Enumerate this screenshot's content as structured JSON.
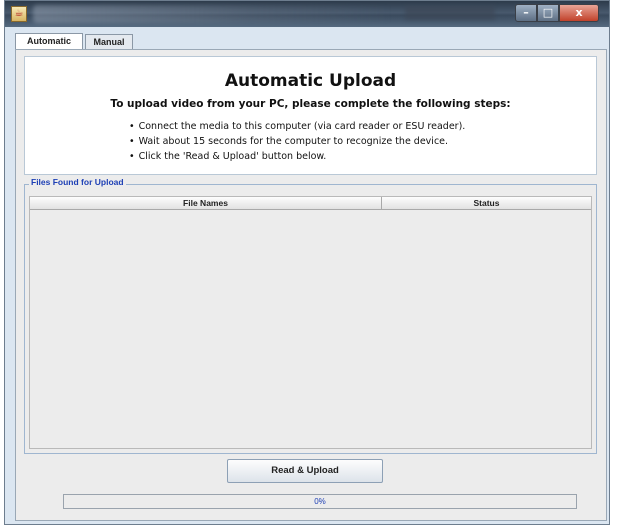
{
  "window": {
    "app_icon": "java-cup-icon",
    "controls": {
      "minimize": "–",
      "maximize": "□",
      "close": "x"
    }
  },
  "tabs": [
    {
      "label": "Automatic",
      "active": true
    },
    {
      "label": "Manual",
      "active": false
    }
  ],
  "header": {
    "title": "Automatic Upload",
    "subtitle": "To upload video from your PC, please complete the following steps:",
    "steps": [
      "Connect the media to this computer (via card reader or ESU reader).",
      "Wait about 15 seconds for the computer to recognize the device.",
      "Click the 'Read & Upload' button below."
    ]
  },
  "files": {
    "group_label": "Files Found for Upload",
    "columns": [
      "File Names",
      "Status"
    ],
    "rows": []
  },
  "actions": {
    "read_upload_label": "Read & Upload"
  },
  "progress": {
    "value": 0,
    "label": "0%"
  },
  "colors": {
    "accent_text": "#1d3fb5",
    "panel_bg": "#ececec",
    "window_frame": "#dbe6f1"
  }
}
